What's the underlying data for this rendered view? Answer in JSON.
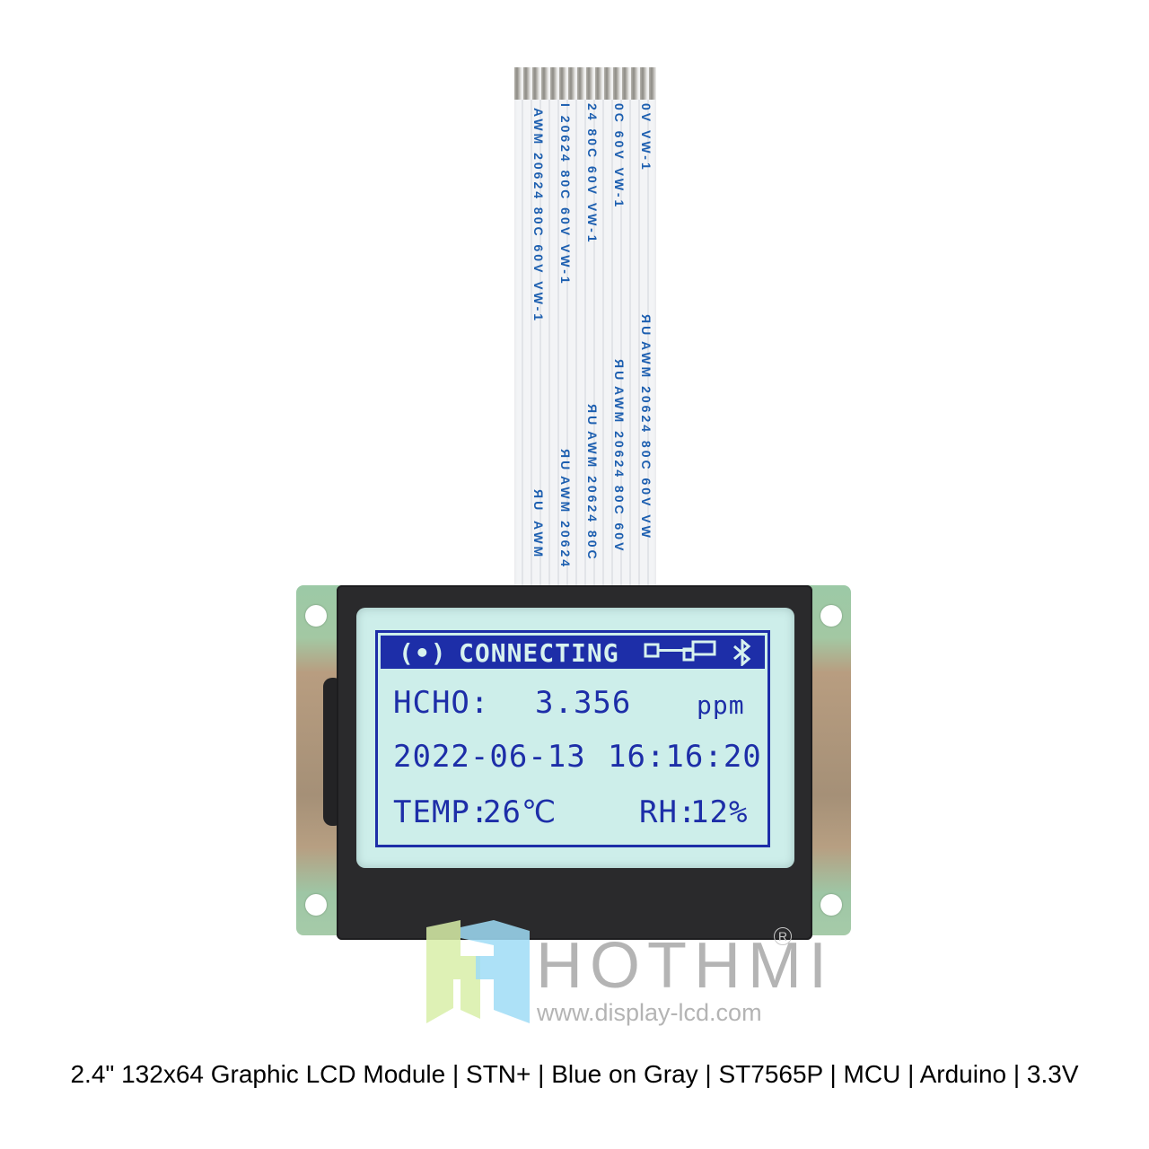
{
  "product": {
    "caption": "2.4\" 132x64 Graphic LCD Module | STN+ | Blue on Gray | ST7565P | MCU | Arduino | 3.3V",
    "brand": "HOTHMI",
    "registered_mark": "R",
    "website": "www.display-lcd.com"
  },
  "fpc_cable": {
    "markings": [
      "0V  VW-1",
      "0C  60V  VW-1",
      "24  80C  60V  VW-1",
      "I  20624  80C  60V  VW-1",
      "AWM  20624  80C  60V  VW-1",
      "AWM  20624  80C  60V  VW",
      "AWM  20624  80C  60V",
      "AWM  20624  80C",
      "AWM  20624",
      "AWM"
    ],
    "ul_mark": "ЯU"
  },
  "lcd": {
    "header": {
      "signal_icon": "(•)",
      "status": "CONNECTING",
      "key_icon": "key-icon",
      "bluetooth_icon": "bluetooth-icon"
    },
    "rows": [
      {
        "label": "HCHO:",
        "value": "3.356",
        "unit": "ppm"
      },
      {
        "date": "2022-06-13",
        "time": "16:16:20"
      },
      {
        "temp_label": "TEMP:",
        "temp_value": "26℃",
        "rh_label": "RH:",
        "rh_value": "12%"
      }
    ],
    "colors": {
      "pixel": "#1d2ea8",
      "background": "#cdeeea"
    }
  }
}
